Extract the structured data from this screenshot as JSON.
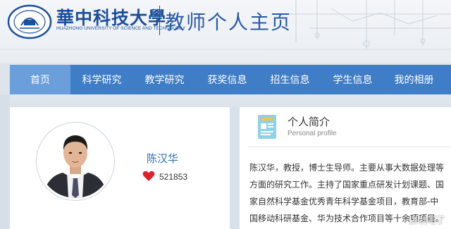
{
  "header": {
    "university_name_cn": "華中科技大學",
    "university_name_en": "HUAZHONG UNIVERSITY OF SCIENCE AND TECHNOLOGY",
    "site_title": "教师个人主页",
    "logo_icon": "hust-seal-icon"
  },
  "nav": {
    "items": [
      {
        "label": "首页",
        "active": true
      },
      {
        "label": "科学研究",
        "active": false
      },
      {
        "label": "教学研究",
        "active": false
      },
      {
        "label": "获奖信息",
        "active": false
      },
      {
        "label": "招生信息",
        "active": false
      },
      {
        "label": "学生信息",
        "active": false
      },
      {
        "label": "我的相册",
        "active": false
      }
    ]
  },
  "profile_card": {
    "name": "陈汉华",
    "likes": "521853",
    "like_icon": "heart-icon",
    "avatar_icon": "avatar-portrait"
  },
  "intro": {
    "title": "个人简介",
    "subtitle": "Personal profile",
    "icon": "profile-document-icon",
    "lines": [
      "陈汉华，教授，博士生导师。主要从事大数据处理等",
      "方面的研究工作。主持了国家重点研发计划课题、国",
      "家自然科学基金优秀青年科学基金项目，教育部-中",
      "国移动科研基金、华为技术合作项目等十余项项目。"
    ]
  },
  "watermark": "拼制吧了",
  "colors": {
    "brand_blue": "#1c4f9c",
    "nav_blue": "#3f7dc6",
    "nav_active": "#6a9fdc",
    "name_blue": "#2f6fb8",
    "heart_red": "#d9232e"
  }
}
